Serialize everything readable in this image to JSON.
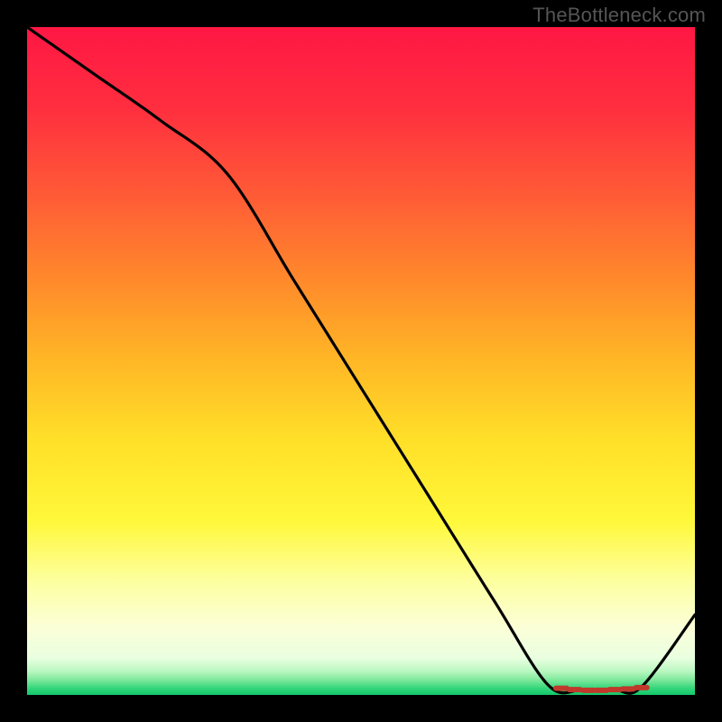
{
  "watermark": "TheBottleneck.com",
  "chart_data": {
    "type": "line",
    "title": "",
    "xlabel": "",
    "ylabel": "",
    "xlim": [
      0,
      100
    ],
    "ylim": [
      0,
      100
    ],
    "series": [
      {
        "name": "curve",
        "x": [
          0,
          10,
          20,
          30,
          40,
          50,
          60,
          70,
          78,
          83,
          88,
          92,
          100
        ],
        "y": [
          100,
          93,
          86,
          78,
          62,
          46,
          30,
          14,
          1.5,
          0.7,
          0.7,
          1.2,
          12
        ]
      }
    ],
    "markers": {
      "name": "optimal-range",
      "x": [
        80,
        82,
        84,
        86,
        88,
        90,
        92
      ],
      "y": [
        1.0,
        0.8,
        0.7,
        0.7,
        0.8,
        0.9,
        1.1
      ]
    },
    "gradient_bands": [
      {
        "pos": 0.0,
        "color": "#ff1744"
      },
      {
        "pos": 0.12,
        "color": "#ff2e3f"
      },
      {
        "pos": 0.25,
        "color": "#ff5a36"
      },
      {
        "pos": 0.38,
        "color": "#ff8a2b"
      },
      {
        "pos": 0.5,
        "color": "#ffb726"
      },
      {
        "pos": 0.62,
        "color": "#ffe028"
      },
      {
        "pos": 0.74,
        "color": "#fff83a"
      },
      {
        "pos": 0.83,
        "color": "#fdffa0"
      },
      {
        "pos": 0.9,
        "color": "#fbffd8"
      },
      {
        "pos": 0.945,
        "color": "#e9ffe0"
      },
      {
        "pos": 0.965,
        "color": "#b8f7c0"
      },
      {
        "pos": 0.978,
        "color": "#7be89a"
      },
      {
        "pos": 0.99,
        "color": "#34d67a"
      },
      {
        "pos": 1.0,
        "color": "#12c96b"
      }
    ]
  }
}
